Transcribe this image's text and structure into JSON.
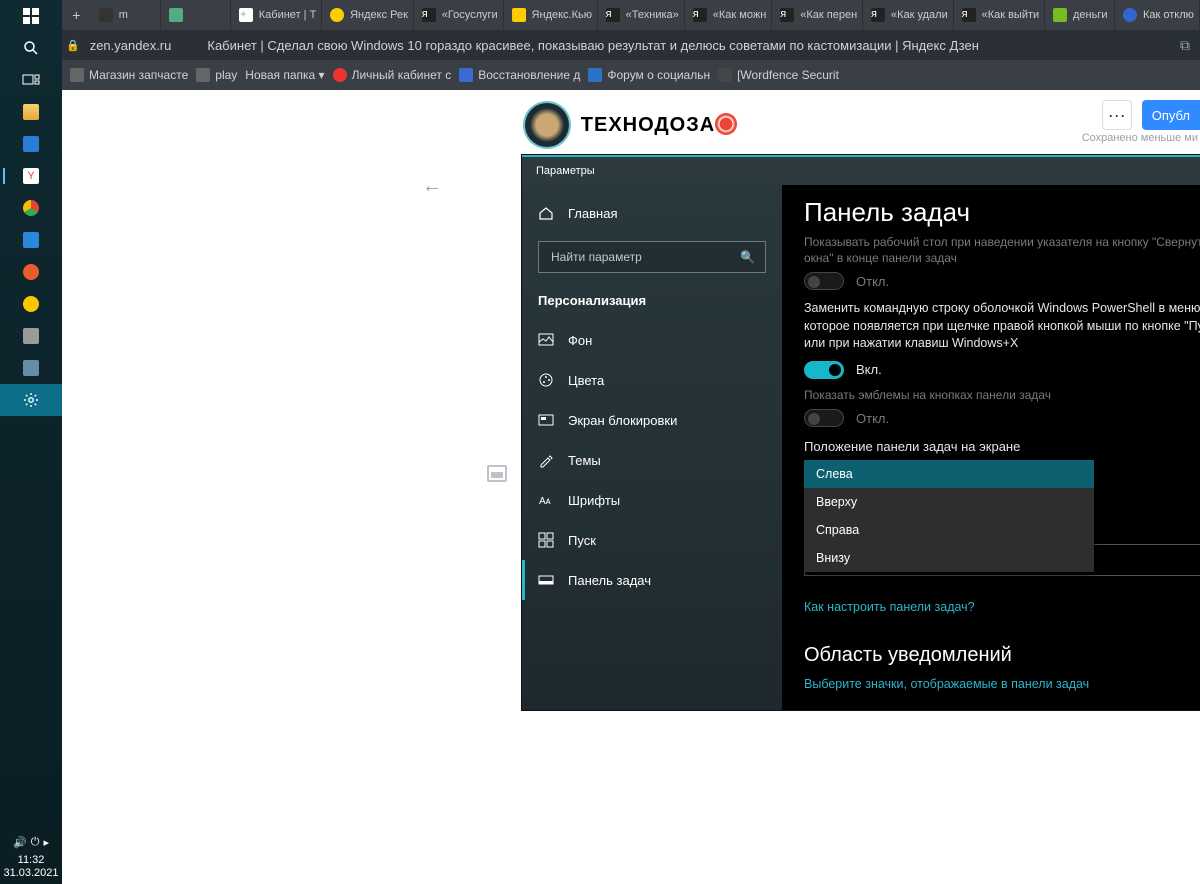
{
  "taskbar": {
    "time": "11:32",
    "date": "31.03.2021"
  },
  "browser": {
    "tabs": [
      {
        "label": "m"
      },
      {
        "label": " "
      },
      {
        "label": "Кабинет | Т"
      },
      {
        "label": "Яндекс Рек"
      },
      {
        "label": "«Госуслуги"
      },
      {
        "label": "Яндекс.Кью"
      },
      {
        "label": "«Техника»"
      },
      {
        "label": "«Как можн"
      },
      {
        "label": "«Как перен"
      },
      {
        "label": "«Как удали"
      },
      {
        "label": "«Как выйти"
      },
      {
        "label": "деньги"
      },
      {
        "label": "Как отклю"
      }
    ],
    "newtab": "+",
    "url": "zen.yandex.ru",
    "page_title": "Кабинет | Сделал свою Windows 10 гораздо красивее, показываю результат и делюсь советами по кастомизации | Яндекс Дзен",
    "bookmarks": [
      {
        "label": "Магазин запчасте"
      },
      {
        "label": "play"
      },
      {
        "label": "Новая папка ▾"
      },
      {
        "label": "Личный кабинет с"
      },
      {
        "label": "Восстановление д"
      },
      {
        "label": "Форум о социальн"
      },
      {
        "label": "[Wordfence Securit"
      }
    ]
  },
  "zen": {
    "brand": "ТЕХНОДОЗА",
    "more": "···",
    "publish": "Опубл",
    "save_status": "Сохранено меньше ми"
  },
  "settings": {
    "title": "Параметры",
    "home": "Главная",
    "search_placeholder": "Найти параметр",
    "section": "Персонализация",
    "nav": {
      "background": "Фон",
      "colors": "Цвета",
      "lock": "Экран блокировки",
      "themes": "Темы",
      "fonts": "Шрифты",
      "start": "Пуск",
      "taskbar": "Панель задач"
    },
    "content": {
      "heading": "Панель задач",
      "faded_desc": "Показывать рабочий стол при наведении указателя на кнопку \"Свернуть все окна\" в конце панели задач",
      "t_off1": "Откл.",
      "powershell": "Заменить командную строку оболочкой Windows PowerShell в меню, которое появляется при щелчке правой кнопкой мыши по кнопке \"Пуск\" или при нажатии клавиш Windows+X",
      "t_on": "Вкл.",
      "badges": "Показать эмблемы на кнопках панели задач",
      "t_off2": "Откл.",
      "position": "Положение панели задач на экране",
      "dd": {
        "left": "Слева",
        "top": "Вверху",
        "right": "Справа",
        "bottom": "Внизу"
      },
      "howto": "Как настроить панели задач?",
      "notif_head": "Область уведомлений",
      "notif_link": "Выберите значки, отображаемые в панели задач"
    }
  }
}
